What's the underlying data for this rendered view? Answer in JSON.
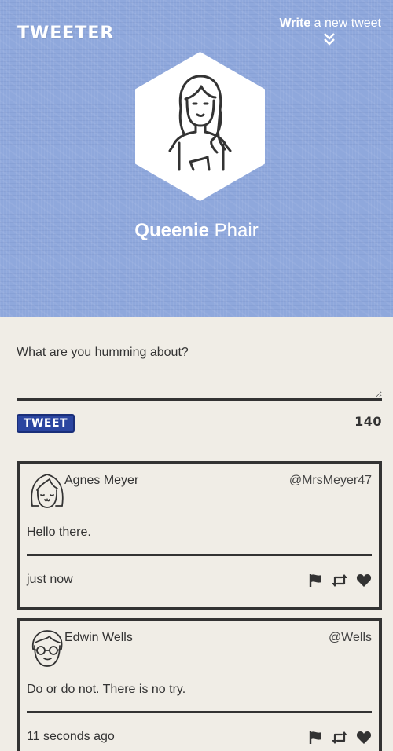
{
  "header": {
    "logo": "TWEETER",
    "write_bold": "Write",
    "write_rest": " a new tweet"
  },
  "profile": {
    "first_name": "Queenie",
    "last_name": " Phair"
  },
  "composer": {
    "placeholder": "What are you humming about?",
    "button_label": "TWEET",
    "char_count": "140"
  },
  "tweets": [
    {
      "name": "Agnes Meyer",
      "handle": "@MrsMeyer47",
      "text": "Hello there.",
      "time": "just now",
      "avatar_icon": "girl-avatar-icon"
    },
    {
      "name": "Edwin Wells",
      "handle": "@Wells",
      "text": "Do or do not. There is no try.",
      "time": "11 seconds ago",
      "avatar_icon": "glasses-man-avatar-icon"
    }
  ],
  "colors": {
    "hero_background": "#8fa8dc",
    "page_background": "#f0ede6",
    "button": "#2b45a0",
    "ink": "#333333"
  }
}
